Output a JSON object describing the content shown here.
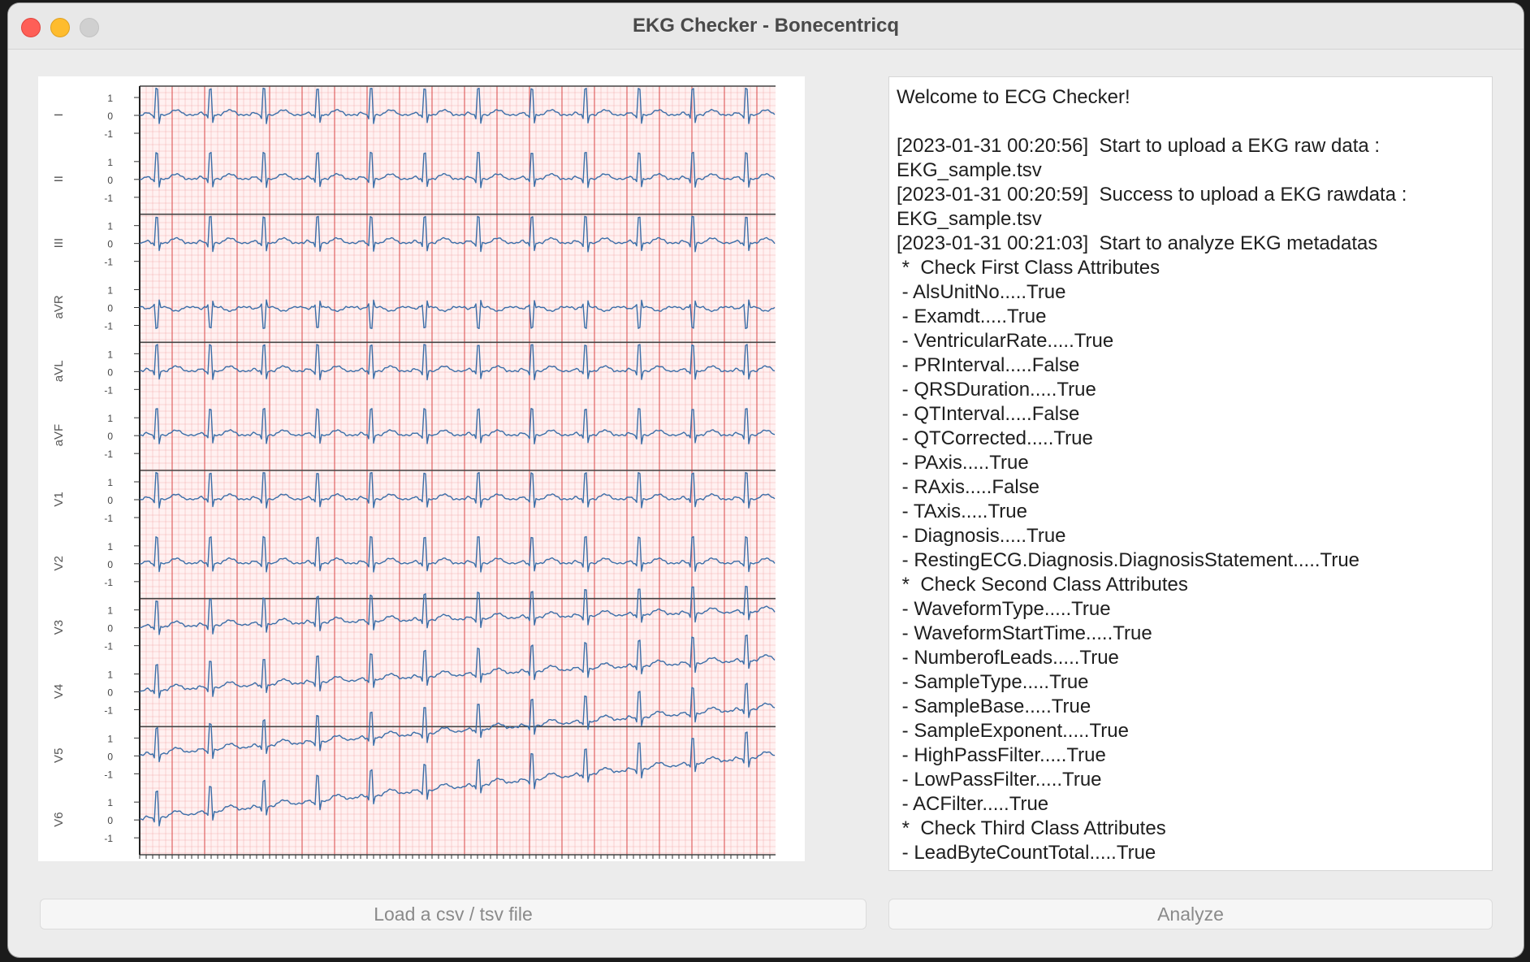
{
  "window": {
    "title": "EKG Checker - Bonecentricq"
  },
  "ekg": {
    "leads": [
      "I",
      "II",
      "III",
      "aVR",
      "aVL",
      "aVF",
      "V1",
      "V2",
      "V3",
      "V4",
      "V5",
      "V6"
    ],
    "scale_ticks": [
      "1",
      "0",
      "-1"
    ],
    "grid_color": "#f2a0a0",
    "trace_color": "#3b6ea8"
  },
  "log": {
    "lines": [
      "Welcome to ECG Checker!",
      "",
      "[2023-01-31 00:20:56]  Start to upload a EKG raw data :",
      "EKG_sample.tsv",
      "[2023-01-31 00:20:59]  Success to upload a EKG rawdata :",
      "EKG_sample.tsv",
      "[2023-01-31 00:21:03]  Start to analyze EKG metadatas",
      " *  Check First Class Attributes",
      " - AlsUnitNo.....True",
      " - Examdt.....True",
      " - VentricularRate.....True",
      " - PRInterval.....False",
      " - QRSDuration.....True",
      " - QTInterval.....False",
      " - QTCorrected.....True",
      " - PAxis.....True",
      " - RAxis.....False",
      " - TAxis.....True",
      " - Diagnosis.....True",
      " - RestingECG.Diagnosis.DiagnosisStatement.....True",
      " *  Check Second Class Attributes",
      " - WaveformType.....True",
      " - WaveformStartTime.....True",
      " - NumberofLeads.....True",
      " - SampleType.....True",
      " - SampleBase.....True",
      " - SampleExponent.....True",
      " - HighPassFilter.....True",
      " - LowPassFilter.....True",
      " - ACFilter.....True",
      " *  Check Third Class Attributes",
      " - LeadByteCountTotal.....True"
    ]
  },
  "buttons": {
    "load_label": "Load a csv / tsv file",
    "analyze_label": "Analyze"
  }
}
